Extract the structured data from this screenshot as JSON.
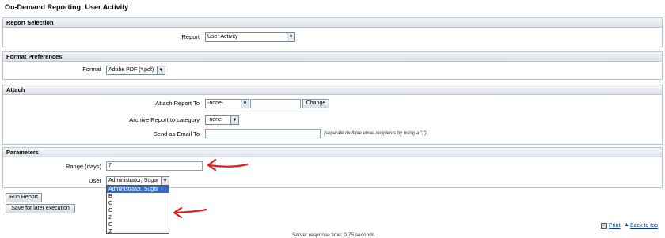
{
  "page": {
    "title": "On-Demand Reporting: User Activity"
  },
  "report_selection": {
    "heading": "Report Selection",
    "report_label": "Report",
    "report_value": "User Activity"
  },
  "format_preferences": {
    "heading": "Format Preferences",
    "format_label": "Format",
    "format_value": "Adobe PDF (*.pdf)"
  },
  "attach": {
    "heading": "Attach",
    "attach_label": "Attach Report To",
    "attach_value": "-none-",
    "change_button": "Change",
    "archive_label": "Archive Report to category",
    "archive_value": "-none-",
    "email_label": "Send as Email To",
    "email_value": "",
    "email_hint": "(separate multiple email recipients by using a \";\")"
  },
  "parameters": {
    "heading": "Parameters",
    "range_label": "Range (days)",
    "range_value": "7",
    "user_label": "User",
    "user_value": "Administrator, Sugar",
    "user_options": [
      "Administrator, Sugar",
      "B",
      "C",
      "C",
      "2",
      "C",
      "Z"
    ]
  },
  "actions": {
    "run_report": "Run Report",
    "save_later": "Save for later execution"
  },
  "links": {
    "print": "Print",
    "back_to_top": "Back to top"
  },
  "footer": {
    "server_response": "Server response time: 0.75 seconds"
  },
  "colors": {
    "annotation_arrow": "#e02020",
    "selected_option": "#316ac5",
    "panel_border": "#b9c4d0"
  }
}
